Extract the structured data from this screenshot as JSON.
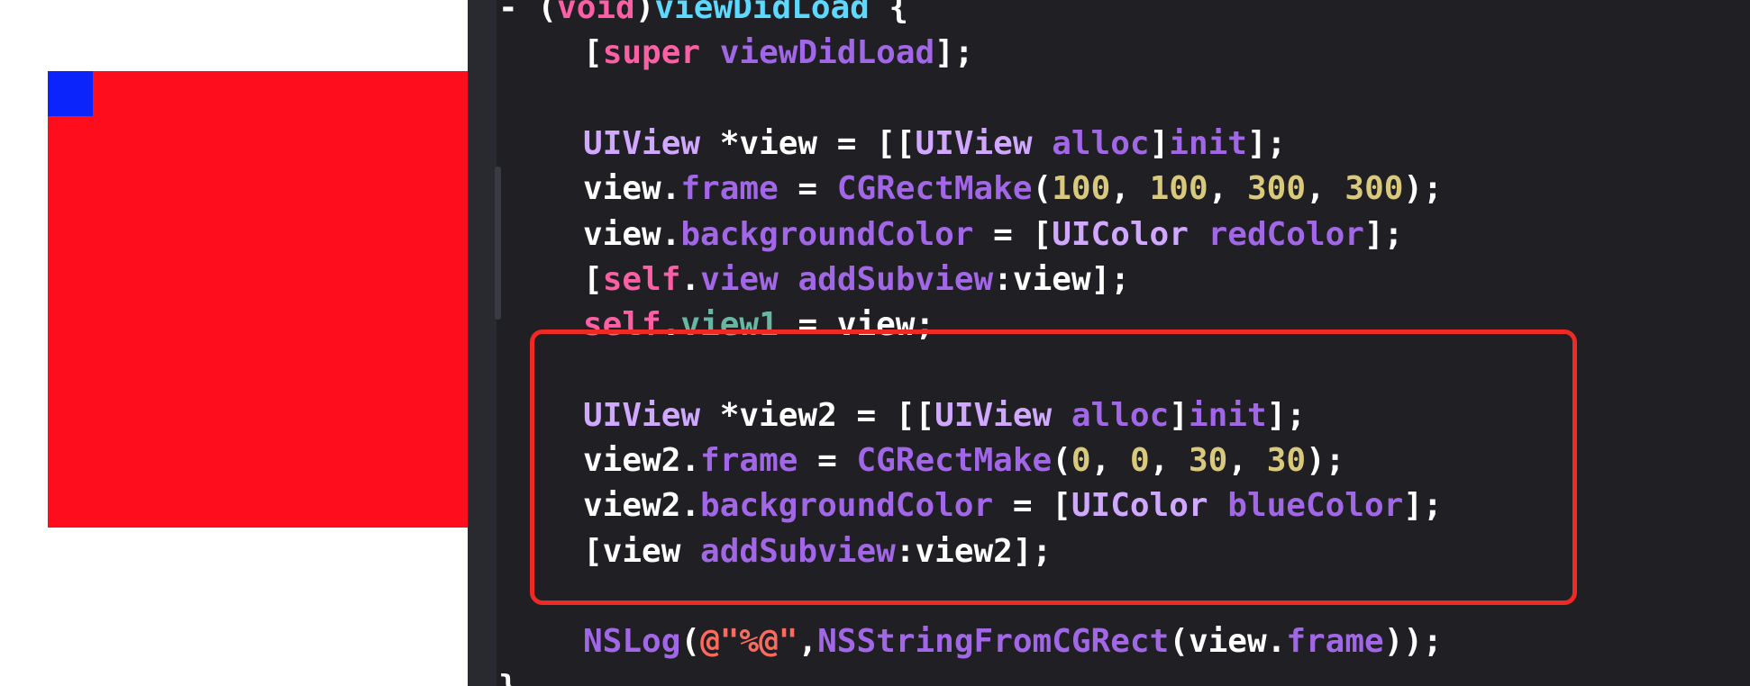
{
  "preview": {
    "parent_view_color": "#fe0e1c",
    "child_view_color": "#0a24fb"
  },
  "editor": {
    "theme_background": "#1f1f24",
    "highlight_color": "#ee2a24",
    "lines": [
      {
        "tokens": [
          [
            "- (",
            "plain"
          ],
          [
            "void",
            "kw"
          ],
          [
            ")",
            "plain"
          ],
          [
            "viewDidLoad",
            "decl"
          ],
          [
            " {",
            "plain"
          ]
        ]
      },
      {
        "tokens": [
          [
            "[",
            "plain"
          ],
          [
            "super",
            "kw"
          ],
          [
            " ",
            "plain"
          ],
          [
            "viewDidLoad",
            "meth"
          ],
          [
            "];",
            "plain"
          ]
        ]
      },
      {
        "tokens": []
      },
      {
        "tokens": [
          [
            "UIView",
            "type"
          ],
          [
            " *view = [[",
            "plain"
          ],
          [
            "UIView",
            "type"
          ],
          [
            " ",
            "plain"
          ],
          [
            "alloc",
            "meth"
          ],
          [
            "]",
            "plain"
          ],
          [
            "init",
            "meth"
          ],
          [
            "];",
            "plain"
          ]
        ]
      },
      {
        "tokens": [
          [
            "view.",
            "plain"
          ],
          [
            "frame",
            "meth"
          ],
          [
            " = ",
            "plain"
          ],
          [
            "CGRectMake",
            "meth"
          ],
          [
            "(",
            "plain"
          ],
          [
            "100",
            "num"
          ],
          [
            ", ",
            "plain"
          ],
          [
            "100",
            "num"
          ],
          [
            ", ",
            "plain"
          ],
          [
            "300",
            "num"
          ],
          [
            ", ",
            "plain"
          ],
          [
            "300",
            "num"
          ],
          [
            ");",
            "plain"
          ]
        ]
      },
      {
        "tokens": [
          [
            "view.",
            "plain"
          ],
          [
            "backgroundColor",
            "meth"
          ],
          [
            " = [",
            "plain"
          ],
          [
            "UIColor",
            "type"
          ],
          [
            " ",
            "plain"
          ],
          [
            "redColor",
            "meth"
          ],
          [
            "];",
            "plain"
          ]
        ]
      },
      {
        "tokens": [
          [
            "[",
            "plain"
          ],
          [
            "self",
            "kw"
          ],
          [
            ".",
            "plain"
          ],
          [
            "view",
            "meth"
          ],
          [
            " ",
            "plain"
          ],
          [
            "addSubview",
            "meth"
          ],
          [
            ":view];",
            "plain"
          ]
        ]
      },
      {
        "tokens": [
          [
            "self",
            "kw"
          ],
          [
            ".",
            "plain"
          ],
          [
            "view1",
            "prop"
          ],
          [
            " = view;",
            "plain"
          ]
        ]
      },
      {
        "tokens": []
      },
      {
        "tokens": [
          [
            "UIView",
            "type"
          ],
          [
            " *view2 = [[",
            "plain"
          ],
          [
            "UIView",
            "type"
          ],
          [
            " ",
            "plain"
          ],
          [
            "alloc",
            "meth"
          ],
          [
            "]",
            "plain"
          ],
          [
            "init",
            "meth"
          ],
          [
            "];",
            "plain"
          ]
        ]
      },
      {
        "tokens": [
          [
            "view2.",
            "plain"
          ],
          [
            "frame",
            "meth"
          ],
          [
            " = ",
            "plain"
          ],
          [
            "CGRectMake",
            "meth"
          ],
          [
            "(",
            "plain"
          ],
          [
            "0",
            "num"
          ],
          [
            ", ",
            "plain"
          ],
          [
            "0",
            "num"
          ],
          [
            ", ",
            "plain"
          ],
          [
            "30",
            "num"
          ],
          [
            ", ",
            "plain"
          ],
          [
            "30",
            "num"
          ],
          [
            ");",
            "plain"
          ]
        ]
      },
      {
        "tokens": [
          [
            "view2.",
            "plain"
          ],
          [
            "backgroundColor",
            "meth"
          ],
          [
            " = [",
            "plain"
          ],
          [
            "UIColor",
            "type"
          ],
          [
            " ",
            "plain"
          ],
          [
            "blueColor",
            "meth"
          ],
          [
            "];",
            "plain"
          ]
        ]
      },
      {
        "tokens": [
          [
            "[view ",
            "plain"
          ],
          [
            "addSubview",
            "meth"
          ],
          [
            ":view2];",
            "plain"
          ]
        ]
      },
      {
        "tokens": []
      },
      {
        "tokens": [
          [
            "NSLog",
            "meth"
          ],
          [
            "(",
            "plain"
          ],
          [
            "@\"%@\"",
            "str"
          ],
          [
            ",",
            "plain"
          ],
          [
            "NSStringFromCGRect",
            "meth"
          ],
          [
            "(view.",
            "plain"
          ],
          [
            "frame",
            "meth"
          ],
          [
            "));",
            "plain"
          ]
        ]
      },
      {
        "tokens": [
          [
            "}",
            "plain"
          ]
        ]
      }
    ]
  }
}
